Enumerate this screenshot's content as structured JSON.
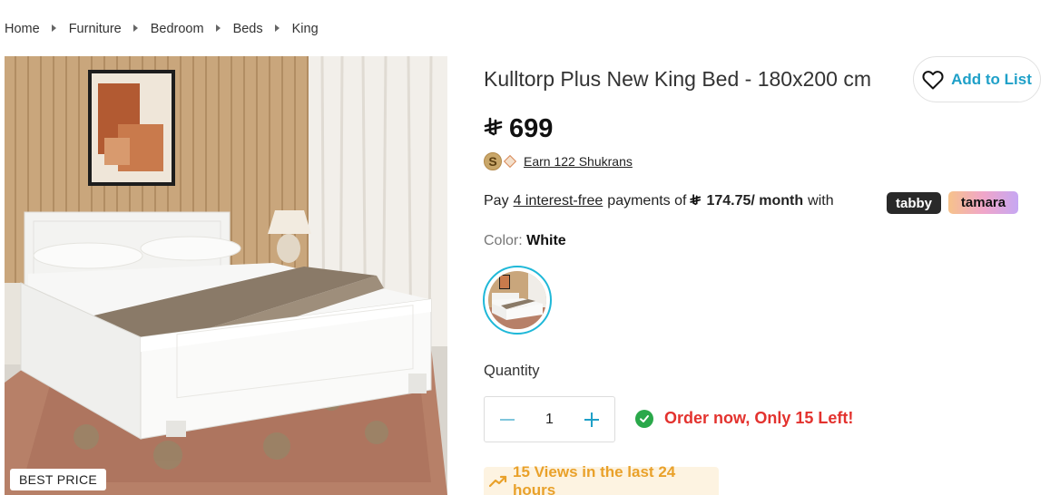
{
  "breadcrumb": [
    "Home",
    "Furniture",
    "Bedroom",
    "Beds",
    "King"
  ],
  "product": {
    "title": "Kulltorp Plus New King Bed - 180x200 cm",
    "badge": "BEST PRICE",
    "price": "699",
    "currency_icon": "saudi-riyal-icon"
  },
  "add_to_list": {
    "label": "Add to List",
    "icon": "heart-icon"
  },
  "shukrans": {
    "text": "Earn 122 Shukrans"
  },
  "installments": {
    "prefix": "Pay",
    "link": "4 interest-free",
    "middle": "payments of",
    "amount": "174.75/ month",
    "suffix": "with",
    "provider_1": "tabby",
    "provider_2": "tamara"
  },
  "color": {
    "label": "Color:",
    "value": "White"
  },
  "quantity": {
    "label": "Quantity",
    "value": "1"
  },
  "stock": {
    "message": "Order now, Only 15 Left!"
  },
  "views": {
    "message": "15 Views in the last 24 hours"
  },
  "colors": {
    "accent": "#1fa0c8",
    "swatch_ring": "#1fb8d8",
    "stock_red": "#e3322e",
    "views_orange": "#e9a12a",
    "check_green": "#2aa84a"
  }
}
